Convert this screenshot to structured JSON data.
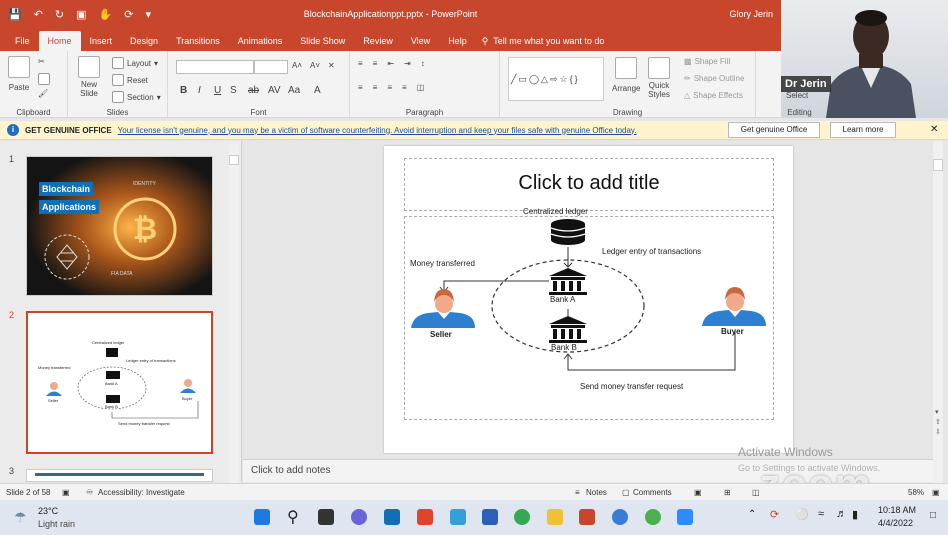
{
  "titlebar": {
    "filename": "BlockchainApplicationppt.pptx",
    "app": "PowerPoint",
    "user": "Glory Jerin"
  },
  "tabs": [
    "File",
    "Home",
    "Insert",
    "Design",
    "Transitions",
    "Animations",
    "Slide Show",
    "Review",
    "View",
    "Help"
  ],
  "tell_me": "Tell me what you want to do",
  "ribbon": {
    "clipboard": {
      "paste": "Paste",
      "label": "Clipboard"
    },
    "slides": {
      "new_slide_1": "New",
      "new_slide_2": "Slide",
      "layout": "Layout",
      "reset": "Reset",
      "section": "Section",
      "label": "Slides"
    },
    "font": {
      "label": "Font",
      "bold": "B",
      "italic": "I",
      "underline": "U",
      "strike": "S",
      "shadow": "ab",
      "spacing": "AV",
      "case": "Aa"
    },
    "paragraph": {
      "label": "Paragraph"
    },
    "drawing": {
      "arrange": "Arrange",
      "quick_styles_1": "Quick",
      "quick_styles_2": "Styles",
      "shape_fill": "Shape Fill",
      "shape_outline": "Shape Outline",
      "shape_effects": "Shape Effects",
      "label": "Drawing"
    },
    "editing": {
      "select": "Select",
      "label": "Editing"
    }
  },
  "video": {
    "participant": "Dr Jerin"
  },
  "message_bar": {
    "title": "GET GENUINE OFFICE",
    "message": "Your license isn't genuine, and you may be a victim of software counterfeiting. Avoid interruption and keep your files safe with genuine Office today.",
    "btn_genuine": "Get genuine Office",
    "btn_learn": "Learn more"
  },
  "thumbnails": {
    "numbers": [
      "1",
      "2",
      "3"
    ],
    "slide1_line1": "Blockchain",
    "slide1_line2": "Applications",
    "slide1_identity": "IDENTITY",
    "slide1_data": "FIA DATA",
    "mini": {
      "ledger": "Centralized ledger",
      "entry": "Ledger entry of transactions",
      "money": "Money transferred",
      "bank_a": "Bank A",
      "bank_b": "Bank B",
      "seller": "Seller",
      "buyer": "Buyer",
      "send": "Send money transfer request"
    }
  },
  "slide": {
    "title_placeholder": "Click to add title",
    "centralized_ledger": "Centralized ledger",
    "ledger_entry": "Ledger entry of transactions",
    "money_transferred": "Money transferred",
    "bank_a": "Bank A",
    "bank_b": "Bank B",
    "seller": "Seller",
    "buyer": "Buyer",
    "send_request": "Send money transfer request"
  },
  "notes_placeholder": "Click to add notes",
  "status": {
    "slide_info": "Slide 2 of 58",
    "accessibility": "Accessibility: Investigate",
    "notes": "Notes",
    "comments": "Comments",
    "zoom": "58%"
  },
  "watermark": {
    "activate": "Activate Windows",
    "activate_sub": "Go to Settings to activate Windows.",
    "zoom": "zoom"
  },
  "taskbar": {
    "temp": "23°C",
    "weather": "Light rain",
    "time": "10:18 AM",
    "date": "4/4/2022"
  },
  "colors": {
    "accent": "#c8472c",
    "person_fill": "#2f7fd0",
    "person_face": "#f2a88a",
    "person_hair": "#c7683e"
  }
}
